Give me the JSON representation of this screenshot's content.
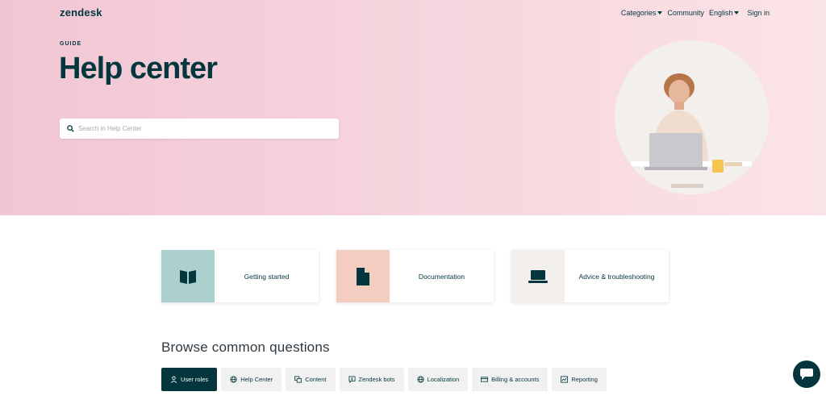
{
  "header": {
    "logo": "zendesk",
    "nav": [
      {
        "label": "Categories",
        "dropdown": true
      },
      {
        "label": "Community",
        "dropdown": false
      },
      {
        "label": "English",
        "dropdown": true
      }
    ],
    "signin_label": "Sign in"
  },
  "hero": {
    "eyebrow": "GUIDE",
    "title": "Help center",
    "search_placeholder": "Search in Help Center",
    "image": "woman-with-laptop-illustration"
  },
  "categories": [
    {
      "label": "Getting started",
      "icon": "book-icon",
      "color": "#acd0cd"
    },
    {
      "label": "Documentation",
      "icon": "document-icon",
      "color": "#f3cdbf"
    },
    {
      "label": "Advice & troubleshooting",
      "icon": "laptop-icon",
      "color": "#f3efed"
    }
  ],
  "browse": {
    "title": "Browse common questions",
    "chips": [
      {
        "label": "User roles",
        "icon": "user-icon",
        "active": true
      },
      {
        "label": "Help Center",
        "icon": "globe-icon",
        "active": false
      },
      {
        "label": "Content",
        "icon": "content-icon",
        "active": false
      },
      {
        "label": "Zendesk bots",
        "icon": "bot-icon",
        "active": false
      },
      {
        "label": "Localization",
        "icon": "globe-icon",
        "active": false
      },
      {
        "label": "Billing & accounts",
        "icon": "card-icon",
        "active": false
      },
      {
        "label": "Reporting",
        "icon": "chart-icon",
        "active": false
      }
    ]
  },
  "chat": {
    "icon": "chat-icon"
  },
  "colors": {
    "brand_dark": "#03363d",
    "hero_pink": "#f1c6d4"
  }
}
